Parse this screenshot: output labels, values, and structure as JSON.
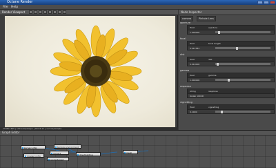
{
  "window": {
    "title": "Octane Render"
  },
  "menu": [
    "File",
    "Help"
  ],
  "viewer": {
    "header": "Render Viewport",
    "status": "2048x1365 | 100 samples/px | 00:02:11 | 1.2 ms/sample",
    "toolbar_icons": [
      "restart-icon",
      "play-icon",
      "pause-icon",
      "stop-icon",
      "camera-icon",
      "zoom-icon",
      "save-icon",
      "settings-icon"
    ]
  },
  "inspector": {
    "header": "Node Inspector",
    "tabs": [
      "camera",
      "Pinhole Lens"
    ],
    "rows": [
      {
        "label": "aperture",
        "type": "float",
        "name": "aperture",
        "value": "1.000000"
      },
      {
        "label": "focal",
        "type": "float",
        "name": "focal length",
        "value": "0.412381"
      },
      {
        "label": "dist",
        "type": "float",
        "name": "dist",
        "value": "0.010000"
      },
      {
        "label": "gamma",
        "type": "float",
        "name": "gamma",
        "value": "1.000000"
      },
      {
        "label": "response",
        "type": "string",
        "name": "response",
        "value": "Kodak 100CD"
      },
      {
        "label": "vignetting",
        "type": "float",
        "name": "vignetting",
        "value": "0.1000"
      }
    ]
  },
  "graph": {
    "header": "Graph Editor",
    "nodes": [
      "kernelconfig",
      "imagerconfig",
      "camera",
      "rendertarget",
      "texture environment",
      "directlighting",
      "mesh"
    ]
  }
}
